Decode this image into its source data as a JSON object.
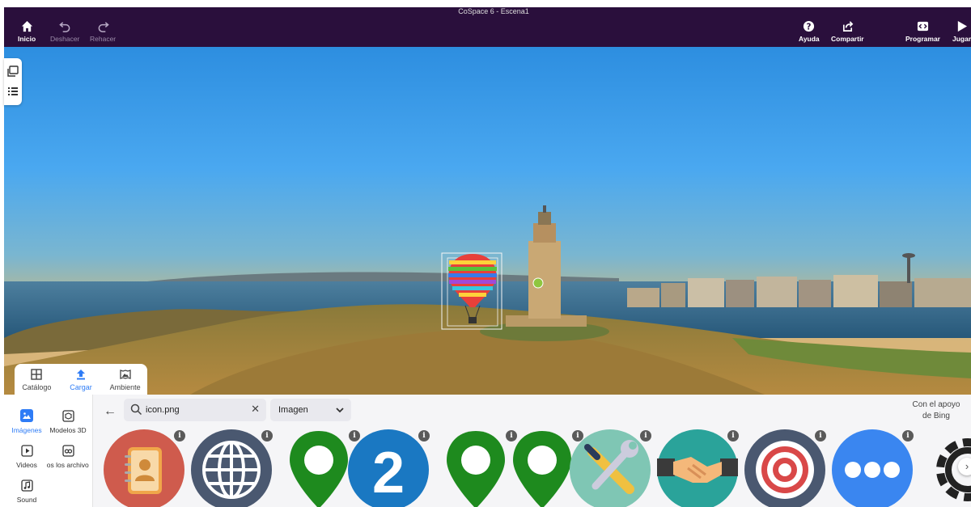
{
  "window_title": "CoSpace 6 - Escena1",
  "toolbar": {
    "home_label": "Inicio",
    "undo_label": "Deshacer",
    "redo_label": "Rehacer",
    "help_label": "Ayuda",
    "share_label": "Compartir",
    "code_label": "Programar",
    "play_label": "Jugar"
  },
  "bottom_tabs": {
    "catalog_label": "Catálogo",
    "upload_label": "Cargar",
    "environment_label": "Ambiente",
    "active": "Cargar"
  },
  "categories": {
    "images_label": "Imágenes",
    "models3d_label": "Modelos 3D",
    "videos_label": "Videos",
    "allfiles_label": "Todos los archivos",
    "sound_label": "Sound",
    "active": "Imágenes"
  },
  "search": {
    "value": "icon.png"
  },
  "filter": {
    "selected": "Imagen"
  },
  "bing_note": "Con el apoyo de Bing",
  "results": [
    {
      "icon": "address-book-icon"
    },
    {
      "icon": "globe-icon"
    },
    {
      "icon": "map-pin-icon"
    },
    {
      "icon": "number-two-icon"
    },
    {
      "icon": "map-pin-icon"
    },
    {
      "icon": "map-pin-icon"
    },
    {
      "icon": "tools-icon"
    },
    {
      "icon": "handshake-icon"
    },
    {
      "icon": "target-icon"
    },
    {
      "icon": "more-icon"
    },
    {
      "icon": "settings-gear-icon"
    }
  ],
  "colors": {
    "topbar": "#2a0f3c",
    "accent": "#2e7cf6",
    "sky_top": "#2d8ee0",
    "pin_green": "#1e8a1e"
  }
}
